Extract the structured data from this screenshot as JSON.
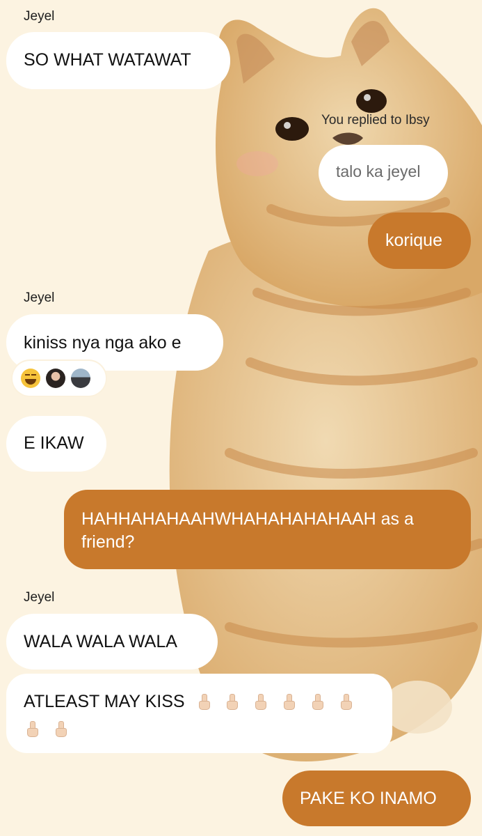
{
  "colors": {
    "background": "#fcf3e1",
    "incoming_bubble": "#ffffff",
    "outgoing_bubble": "#c8792c"
  },
  "messages": [
    {
      "sender": "Jeyel",
      "text": "SO WHAT WATAWAT"
    },
    {
      "reply_caption": "You replied to Ibsy",
      "quoted_text": "talo ka jeyel",
      "text": "korique"
    },
    {
      "sender": "Jeyel",
      "text": "kiniss nya nga ako e"
    },
    {
      "text": "E IKAW"
    },
    {
      "text": "HAHHAHAHAAHWHAHAHAHAHAAH as a friend?"
    },
    {
      "sender": "Jeyel",
      "text": "WALA WALA WALA"
    },
    {
      "text": "ATLEAST MAY KISS",
      "emoji_name": "middle-finger-emoji",
      "emoji_count": 8
    },
    {
      "text": "PAKE KO INAMO"
    }
  ],
  "reactions": [
    "laughing-emoji",
    "avatar-1",
    "avatar-2"
  ]
}
